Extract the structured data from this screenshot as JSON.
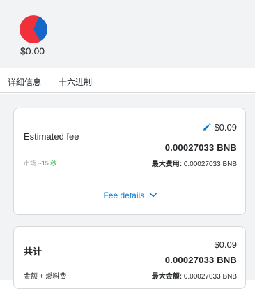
{
  "account": {
    "balance": "$0.00",
    "avatar_colors": [
      "#f0303a",
      "#1466c8"
    ]
  },
  "tabs": [
    {
      "label": "详细信息",
      "active": true
    },
    {
      "label": "十六进制",
      "active": false
    }
  ],
  "fee_card": {
    "title": "Estimated fee",
    "market_label": "市场",
    "market_time": "~15 秒",
    "fiat": "$0.09",
    "amount": "0.00027033 BNB",
    "max_label": "最大费用:",
    "max_value": "0.00027033 BNB",
    "details_link": "Fee details",
    "edit_icon": "pencil-icon",
    "accent_color": "#037dd6",
    "time_color": "#28a745"
  },
  "total_card": {
    "title": "共计",
    "fiat": "$0.09",
    "amount": "0.00027033 BNB",
    "sub_label": "金额 + 燃料费",
    "max_label": "最大金额:",
    "max_value": "0.00027033 BNB"
  }
}
